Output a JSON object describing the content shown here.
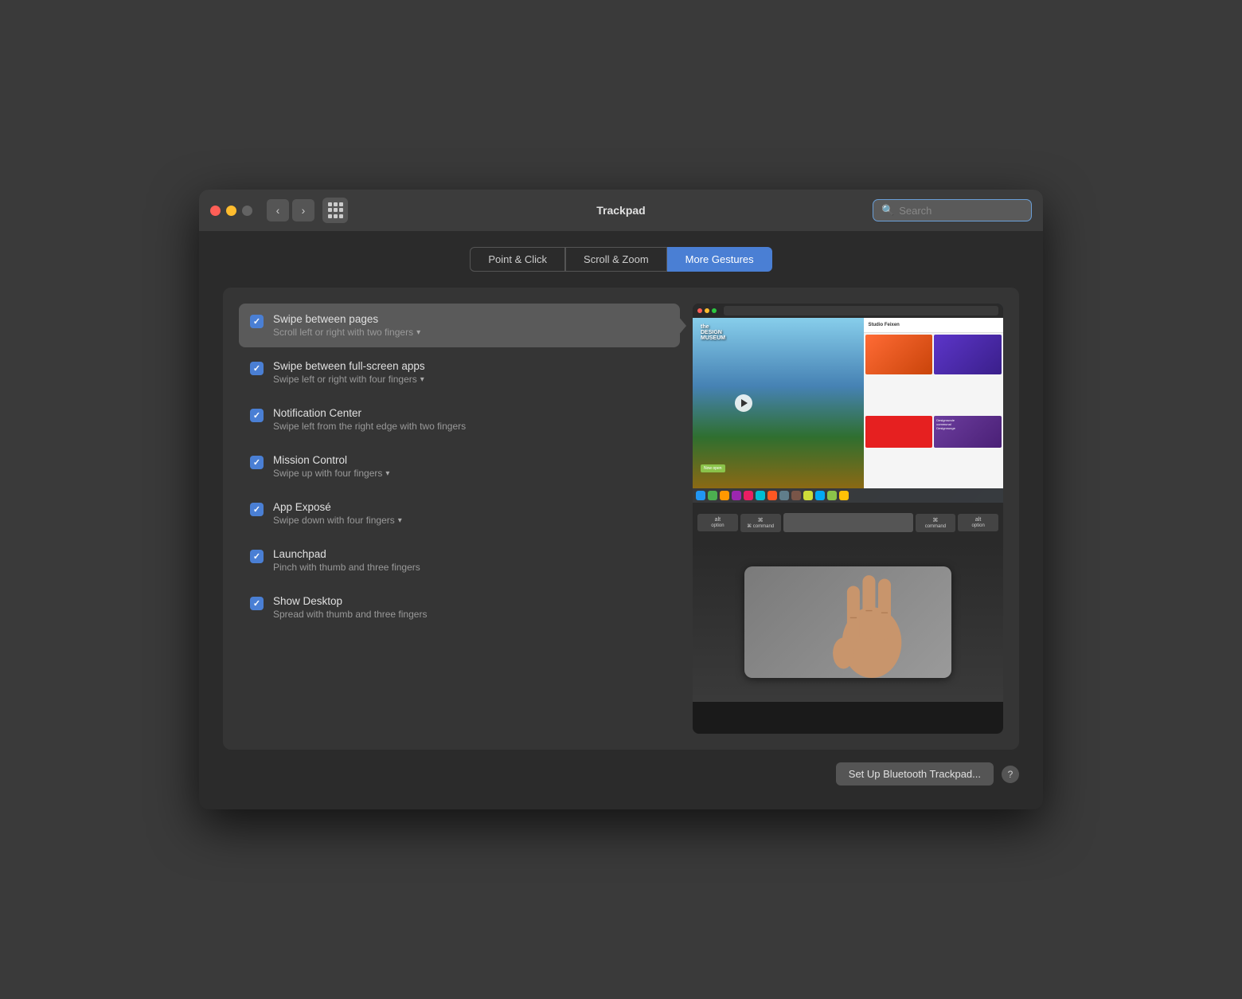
{
  "window": {
    "title": "Trackpad",
    "search_placeholder": "Search"
  },
  "tabs": [
    {
      "id": "point-click",
      "label": "Point & Click",
      "active": false
    },
    {
      "id": "scroll-zoom",
      "label": "Scroll & Zoom",
      "active": false
    },
    {
      "id": "more-gestures",
      "label": "More Gestures",
      "active": true
    }
  ],
  "gestures": [
    {
      "id": "swipe-pages",
      "title": "Swipe between pages",
      "subtitle": "Scroll left or right with two fingers",
      "has_dropdown": true,
      "checked": true,
      "selected": true
    },
    {
      "id": "swipe-fullscreen",
      "title": "Swipe between full-screen apps",
      "subtitle": "Swipe left or right with four fingers",
      "has_dropdown": true,
      "checked": true,
      "selected": false
    },
    {
      "id": "notification-center",
      "title": "Notification Center",
      "subtitle": "Swipe left from the right edge with two fingers",
      "has_dropdown": false,
      "checked": true,
      "selected": false
    },
    {
      "id": "mission-control",
      "title": "Mission Control",
      "subtitle": "Swipe up with four fingers",
      "has_dropdown": true,
      "checked": true,
      "selected": false
    },
    {
      "id": "app-expose",
      "title": "App Exposé",
      "subtitle": "Swipe down with four fingers",
      "has_dropdown": true,
      "checked": true,
      "selected": false
    },
    {
      "id": "launchpad",
      "title": "Launchpad",
      "subtitle": "Pinch with thumb and three fingers",
      "has_dropdown": false,
      "checked": true,
      "selected": false
    },
    {
      "id": "show-desktop",
      "title": "Show Desktop",
      "subtitle": "Spread with thumb and three fingers",
      "has_dropdown": false,
      "checked": true,
      "selected": false
    }
  ],
  "keyboard": {
    "key1": "alt\noption",
    "key2": "⌘\ncommand",
    "key3": "⌘\ncommand",
    "key4": "alt\noption"
  },
  "bottom": {
    "setup_btn": "Set Up Bluetooth Trackpad...",
    "help_btn": "?"
  }
}
